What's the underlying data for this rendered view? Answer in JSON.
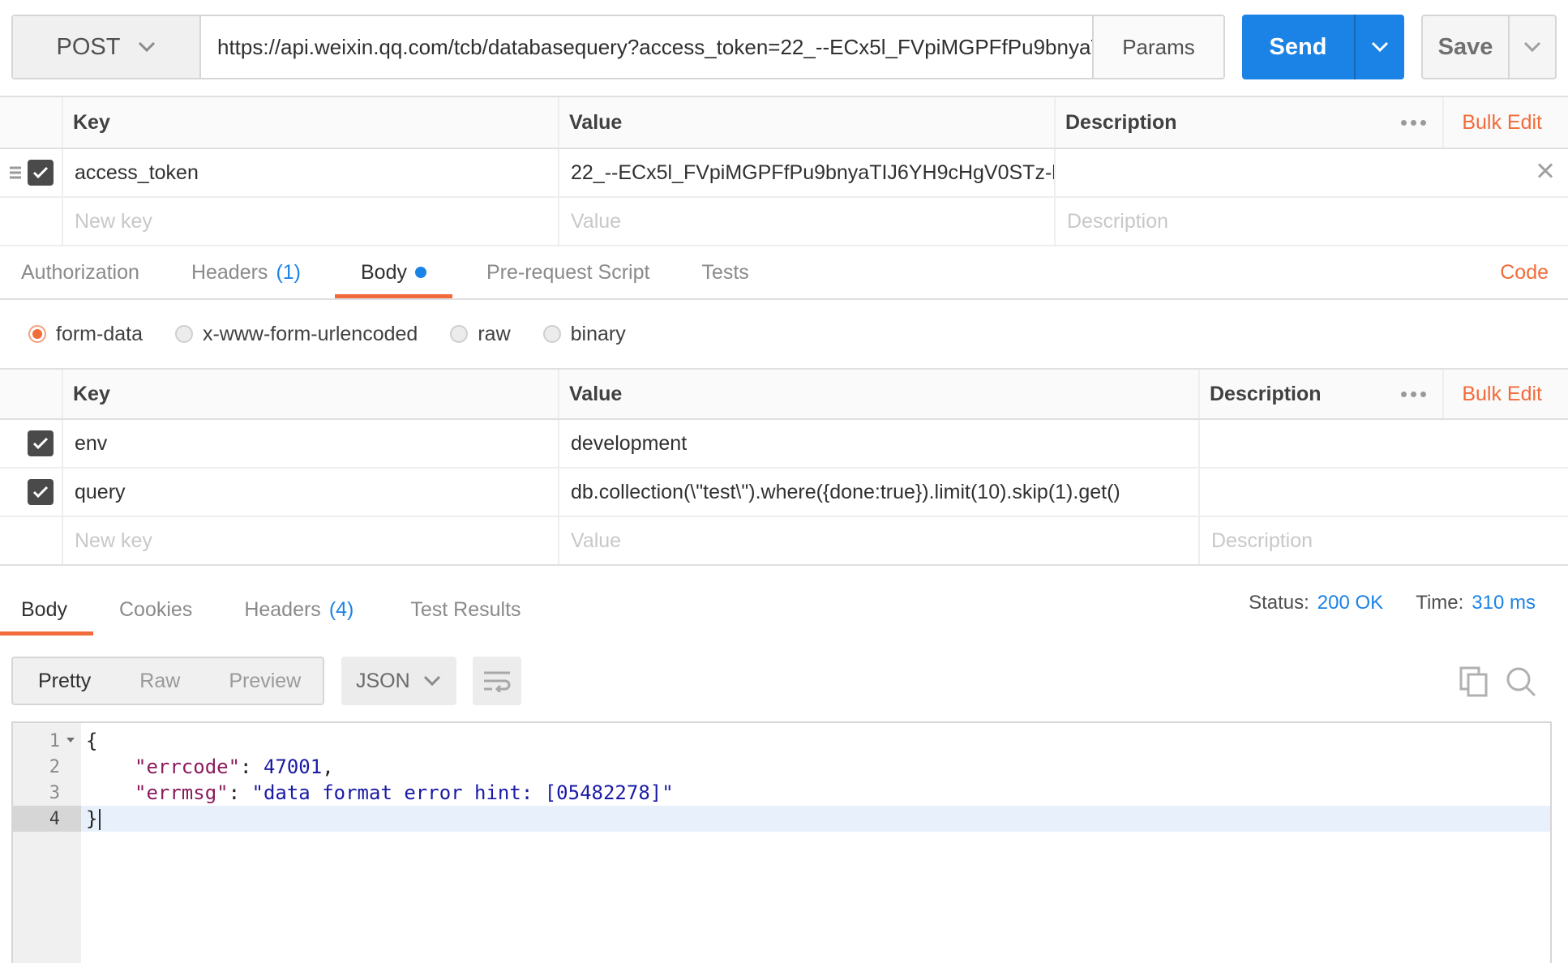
{
  "request": {
    "method": "POST",
    "url": "https://api.weixin.qq.com/tcb/databasequery?access_token=22_--ECx5l_FVpiMGPFfPu9bnyaT...",
    "params_label": "Params",
    "send_label": "Send",
    "save_label": "Save"
  },
  "params_table": {
    "headers": {
      "key": "Key",
      "value": "Value",
      "description": "Description",
      "bulk_edit": "Bulk Edit"
    },
    "rows": [
      {
        "key": "access_token",
        "value": "22_--ECx5l_FVpiMGPFfPu9bnyaTIJ6YH9cHgV0STz-l...",
        "description": "",
        "checked": true
      }
    ],
    "new_row": {
      "key_placeholder": "New key",
      "value_placeholder": "Value",
      "description_placeholder": "Description"
    }
  },
  "request_tabs": {
    "authorization": "Authorization",
    "headers": "Headers",
    "headers_count": "(1)",
    "body": "Body",
    "pre_request": "Pre-request Script",
    "tests": "Tests",
    "code": "Code"
  },
  "body_types": {
    "form_data": "form-data",
    "urlencoded": "x-www-form-urlencoded",
    "raw": "raw",
    "binary": "binary",
    "selected": "form-data"
  },
  "body_table": {
    "headers": {
      "key": "Key",
      "value": "Value",
      "description": "Description",
      "bulk_edit": "Bulk Edit"
    },
    "rows": [
      {
        "key": "env",
        "value": "development",
        "description": "",
        "checked": true
      },
      {
        "key": "query",
        "value": "db.collection(\\\"test\\\").where({done:true}).limit(10).skip(1).get()",
        "description": "",
        "checked": true
      }
    ],
    "new_row": {
      "key_placeholder": "New key",
      "value_placeholder": "Value",
      "description_placeholder": "Description"
    }
  },
  "response_tabs": {
    "body": "Body",
    "cookies": "Cookies",
    "headers": "Headers",
    "headers_count": "(4)",
    "test_results": "Test Results"
  },
  "response_meta": {
    "status_label": "Status:",
    "status_value": "200 OK",
    "time_label": "Time:",
    "time_value": "310 ms"
  },
  "response_view": {
    "pretty": "Pretty",
    "raw": "Raw",
    "preview": "Preview",
    "format": "JSON"
  },
  "response_body": {
    "lines": [
      "1",
      "2",
      "3",
      "4"
    ],
    "open_brace": "{",
    "close_brace": "}",
    "errcode_key": "\"errcode\"",
    "errcode_value": "47001",
    "errmsg_key": "\"errmsg\"",
    "errmsg_value": "\"data format error hint: [05482278]\""
  },
  "colors": {
    "accent_blue": "#1b83e6",
    "accent_orange": "#f26b3a"
  }
}
